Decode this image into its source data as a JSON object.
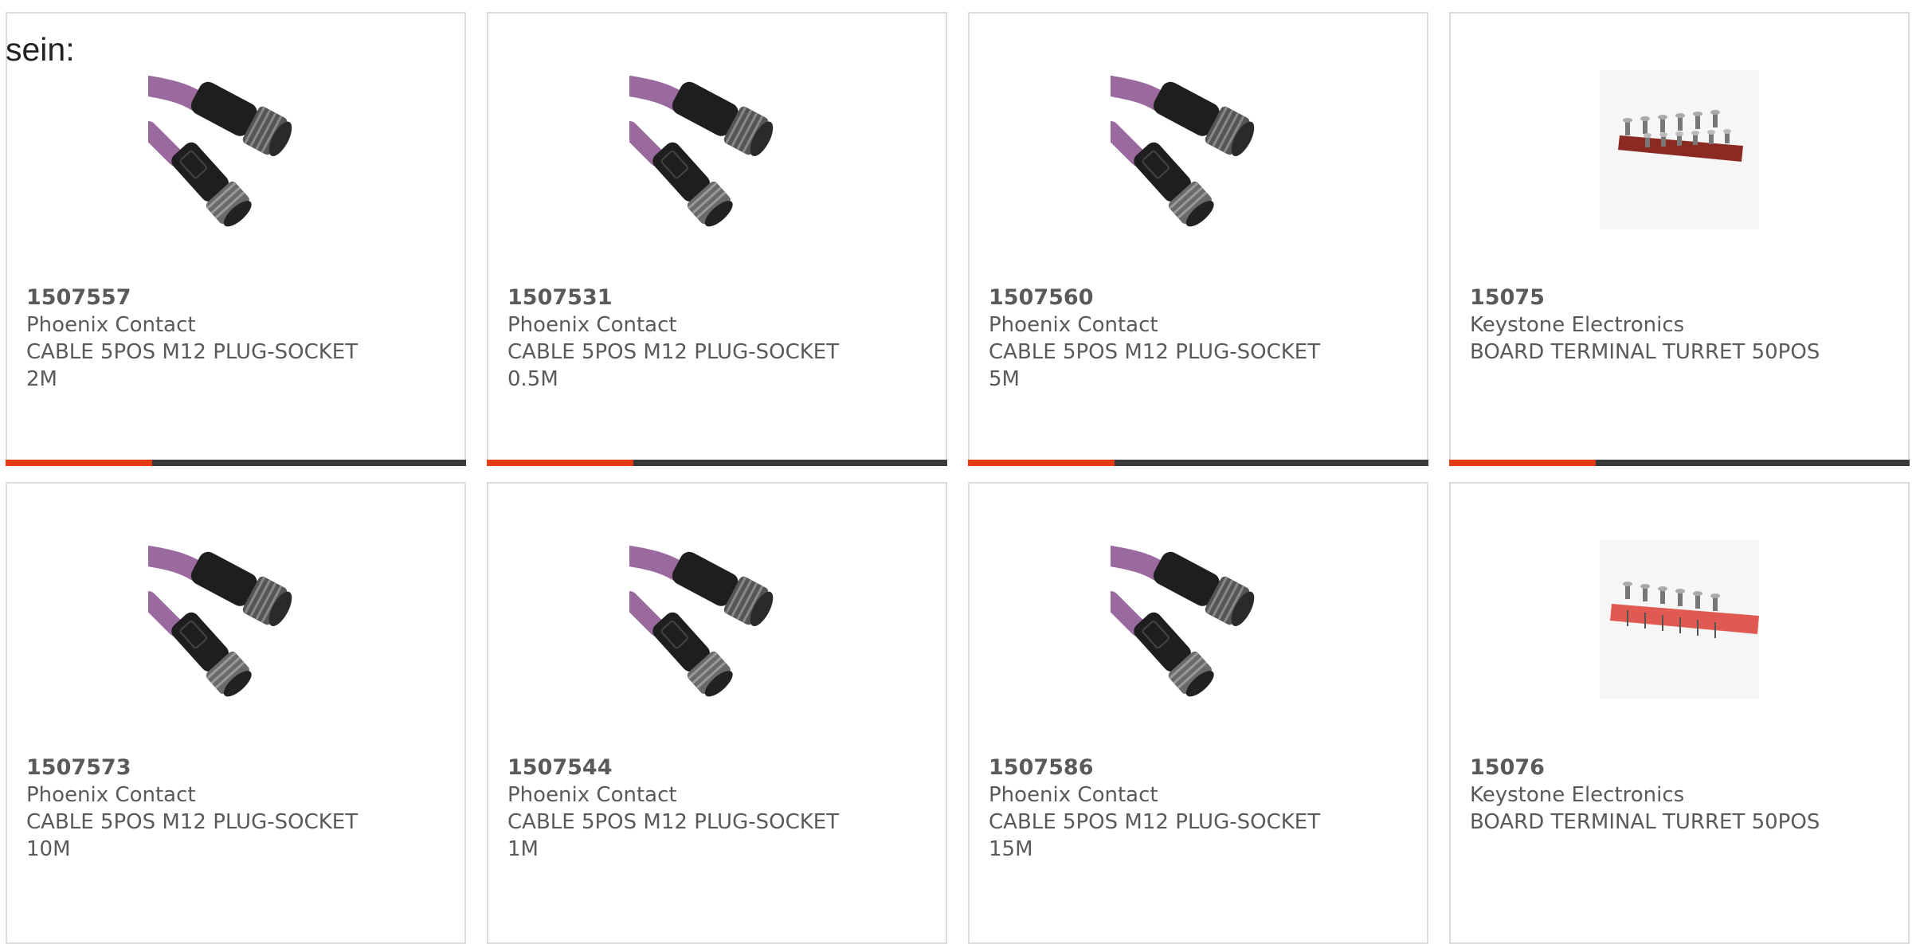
{
  "intro_text": "sein:",
  "products": [
    {
      "part_number": "1507557",
      "manufacturer": "Phoenix Contact",
      "description": "CABLE 5POS M12 PLUG-SOCKET 2M",
      "image": "cable-m12-icon"
    },
    {
      "part_number": "1507531",
      "manufacturer": "Phoenix Contact",
      "description": "CABLE 5POS M12 PLUG-SOCKET 0.5M",
      "image": "cable-m12-icon"
    },
    {
      "part_number": "1507560",
      "manufacturer": "Phoenix Contact",
      "description": "CABLE 5POS M12 PLUG-SOCKET 5M",
      "image": "cable-m12-icon"
    },
    {
      "part_number": "15075",
      "manufacturer": "Keystone Electronics",
      "description": "BOARD TERMINAL TURRET 50POS",
      "image": "terminal-board-dark-icon"
    },
    {
      "part_number": "1507573",
      "manufacturer": "Phoenix Contact",
      "description": "CABLE 5POS M12 PLUG-SOCKET 10M",
      "image": "cable-m12-icon"
    },
    {
      "part_number": "1507544",
      "manufacturer": "Phoenix Contact",
      "description": "CABLE 5POS M12 PLUG-SOCKET 1M",
      "image": "cable-m12-icon"
    },
    {
      "part_number": "1507586",
      "manufacturer": "Phoenix Contact",
      "description": "CABLE 5POS M12 PLUG-SOCKET 15M",
      "image": "cable-m12-icon"
    },
    {
      "part_number": "15076",
      "manufacturer": "Keystone Electronics",
      "description": "BOARD TERMINAL TURRET 50POS",
      "image": "terminal-board-red-icon"
    }
  ],
  "colors": {
    "accent": "#e43a15",
    "bar_dark": "#3a3a3a",
    "text": "#5a5a5a",
    "cable": "#9a6a9e",
    "connector": "#1e1e1e"
  }
}
